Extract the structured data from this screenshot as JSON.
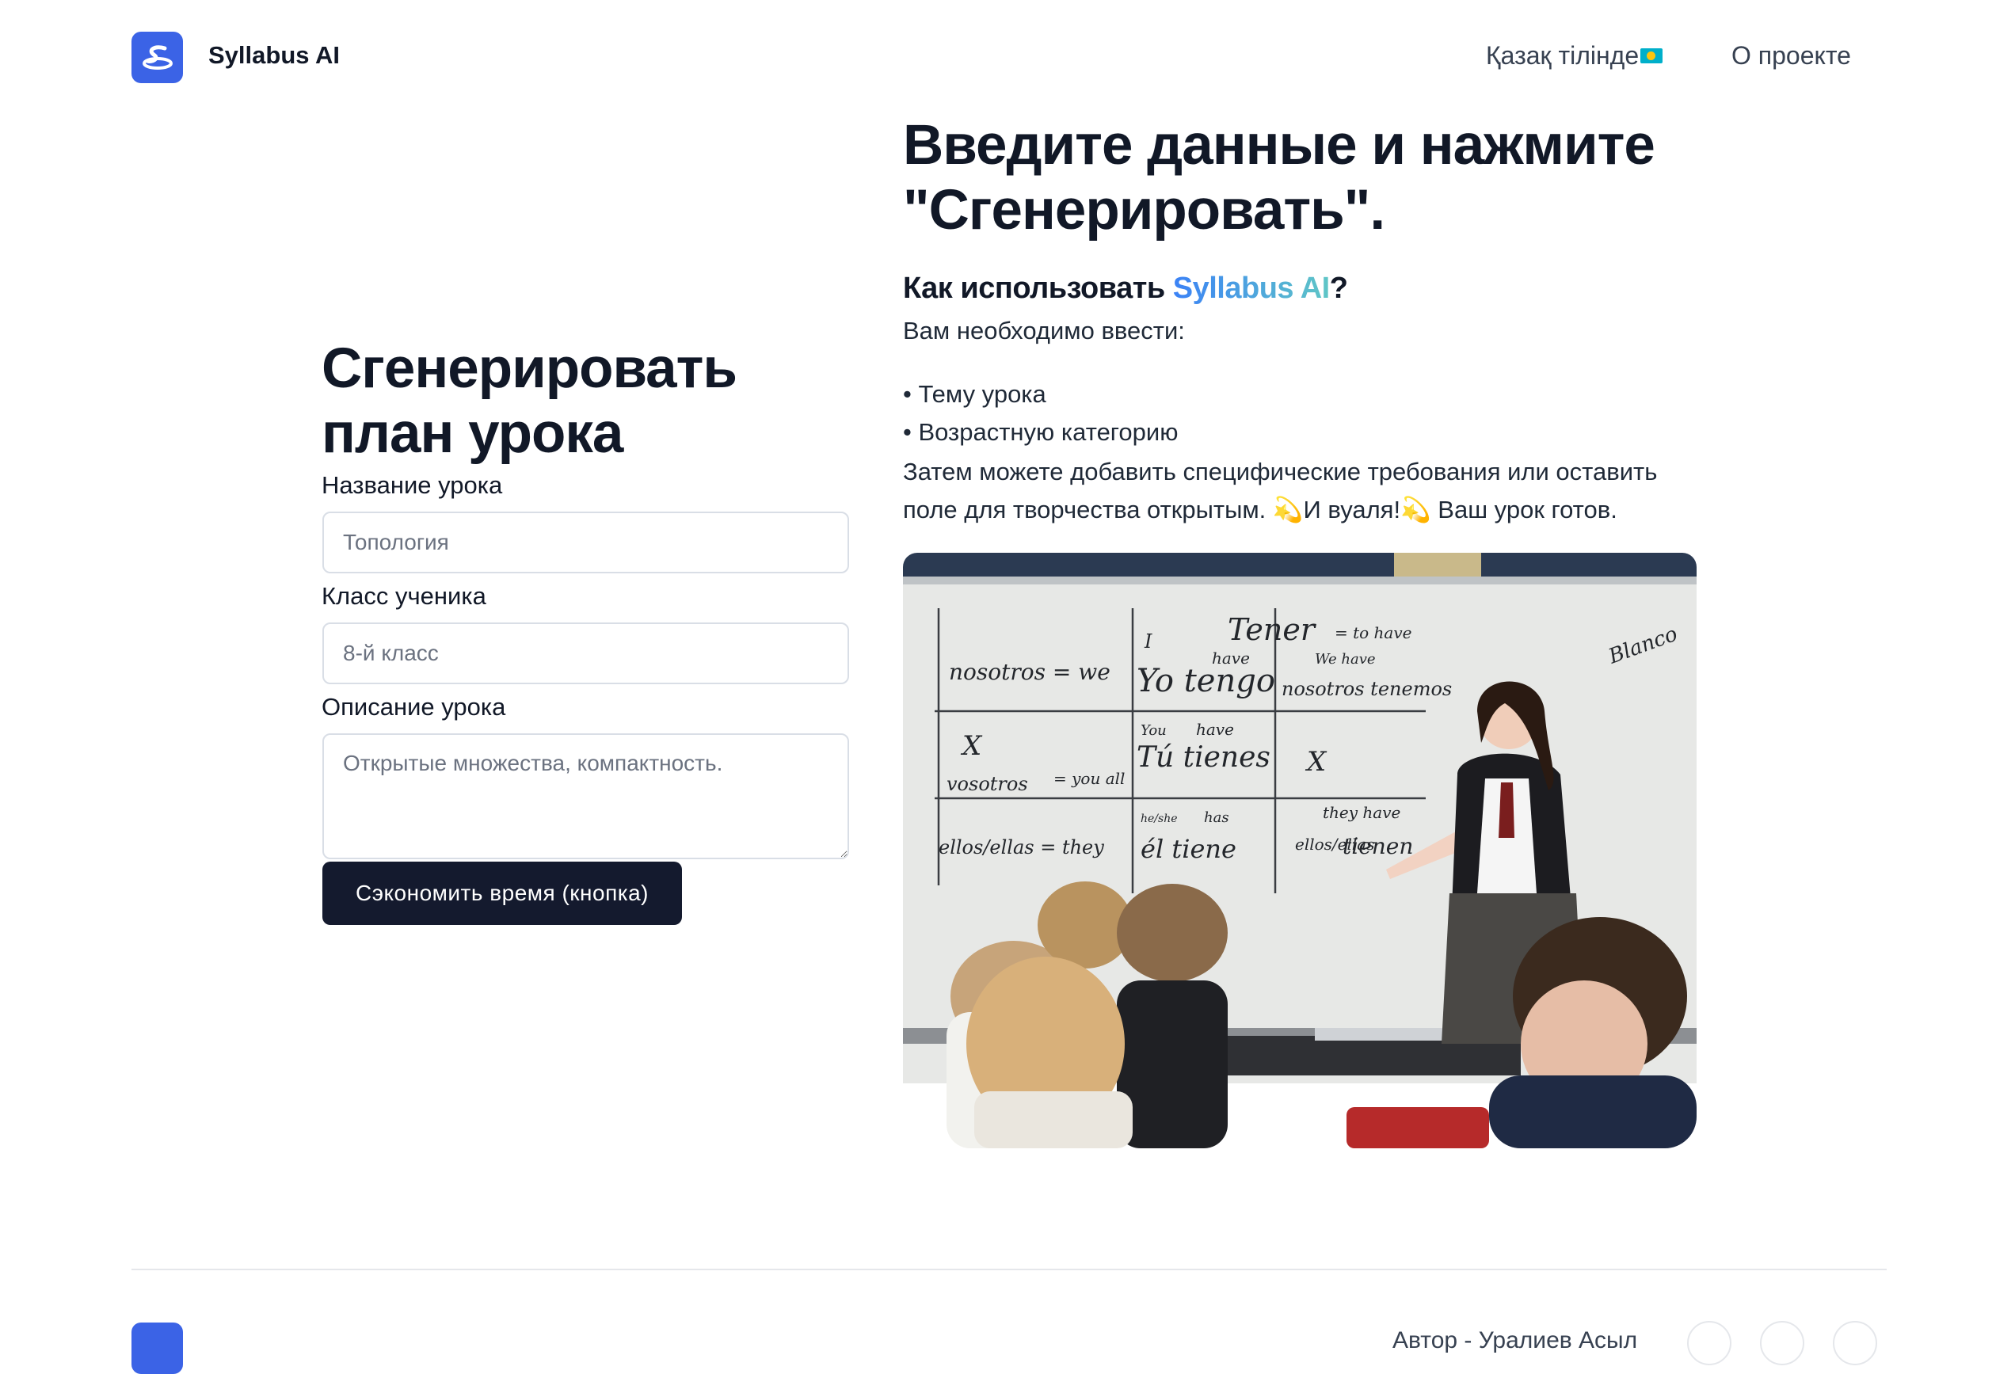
{
  "header": {
    "brand": "Syllabus AI",
    "nav_language": "Қазақ тілінде",
    "nav_about": "О проекте"
  },
  "form": {
    "title_line1": "Сгенерировать",
    "title_line2": "план урока",
    "lesson_name_label": "Название урока",
    "lesson_name_placeholder": "Топология",
    "grade_label": "Класс ученика",
    "grade_placeholder": "8-й класс",
    "description_label": "Описание урока",
    "description_placeholder": "Открытые множества, компактность.",
    "submit_label": "Сэкономить время (кнопка)"
  },
  "info": {
    "title_line1": "Введите данные и нажмите",
    "title_line2": "\"Сгенерировать\".",
    "how_prefix": "Как использовать ",
    "how_brand": "Syllabus AI",
    "how_suffix": "?",
    "need_to_enter": "Вам необходимо ввести:",
    "bullet1": "• Тему урока",
    "bullet2": "• Возрастную категорию",
    "details_line1": "Затем можете добавить специфические требования или оставить",
    "details_line2": "поле для творчества открытым. 💫И вуаля!💫 Ваш урок готов."
  },
  "photo": {
    "board_words": [
      "Tener",
      "= to have",
      "nosotros = we",
      "I",
      "Yo tengo",
      "have",
      "We have",
      "nosotros tenemos",
      "X",
      "vosotros",
      "= you all",
      "You",
      "have",
      "Tú tienes",
      "X",
      "ellos/ellas = they",
      "he/she",
      "has",
      "él tiene",
      "they have",
      "ellos/ellas",
      "tienen",
      "Blanco"
    ]
  },
  "footer": {
    "author": "Автор - Уралиев Асыл"
  },
  "colors": {
    "brand_blue": "#3b63e6",
    "button_dark": "#141a2e",
    "gradient_start": "#3b82f6",
    "gradient_end": "#5fc6c6"
  },
  "icons": [
    "syllabus-logo-icon",
    "kazakhstan-flag-icon",
    "twitter-icon",
    "instagram-icon",
    "github-icon"
  ]
}
